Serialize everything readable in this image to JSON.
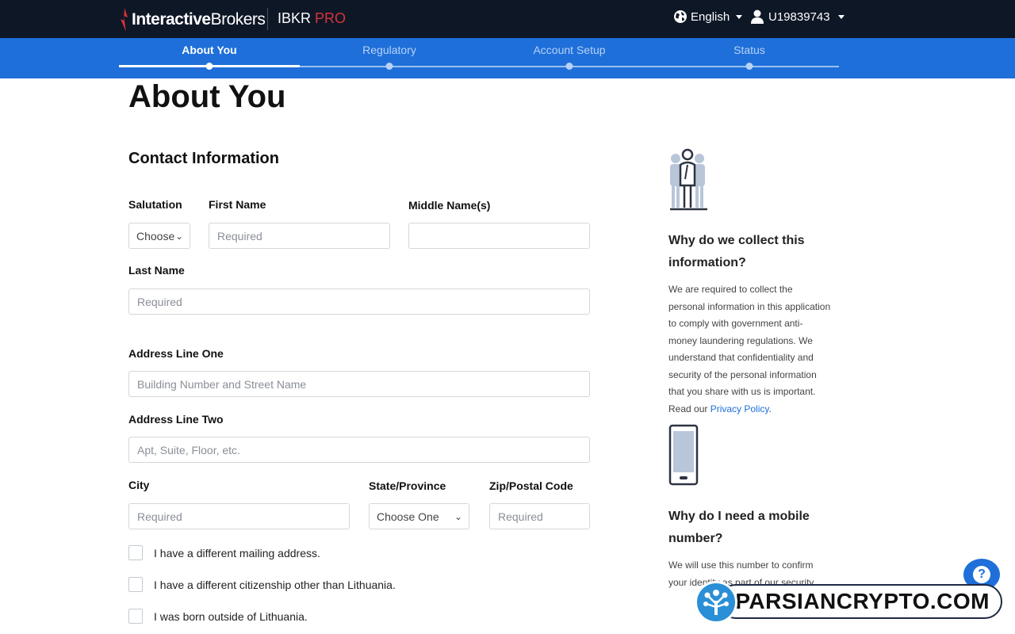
{
  "header": {
    "logo_text_a": "Interactive",
    "logo_text_b": "Brokers",
    "product": "IBKR",
    "product_tier": "PRO",
    "language": "English",
    "user_id": "U19839743"
  },
  "steps": [
    {
      "label": "About You",
      "active": true
    },
    {
      "label": "Regulatory",
      "active": false
    },
    {
      "label": "Account Setup",
      "active": false
    },
    {
      "label": "Status",
      "active": false
    }
  ],
  "page_title": "About You",
  "section_title": "Contact Information",
  "form": {
    "salutation_label": "Salutation",
    "salutation_value": "Choose",
    "first_name_label": "First Name",
    "first_name_placeholder": "Required",
    "middle_name_label": "Middle Name(s)",
    "middle_name_placeholder": "",
    "last_name_label": "Last Name",
    "last_name_placeholder": "Required",
    "address1_label": "Address Line One",
    "address1_placeholder": "Building Number and Street Name",
    "address2_label": "Address Line Two",
    "address2_placeholder": "Apt, Suite, Floor, etc.",
    "city_label": "City",
    "city_placeholder": "Required",
    "state_label": "State/Province",
    "state_value": "Choose One",
    "zip_label": "Zip/Postal Code",
    "zip_placeholder": "Required"
  },
  "checkboxes": [
    "I have a different mailing address.",
    "I have a different citizenship other than Lithuania.",
    "I was born outside of Lithuania."
  ],
  "sidebar": {
    "info_title": "Why do we collect this information?",
    "info_text": "We are required to collect the personal information in this application to comply with government anti-money laundering regulations. We understand that confidentiality and security of the personal information that you share with us is important. Read our ",
    "info_link": "Privacy Policy",
    "info_end": ".",
    "mobile_title": "Why do I need a mobile number?",
    "mobile_text": "We will use this number to confirm your identity as part of our security measures"
  },
  "help_label": "?",
  "watermark": "PARSIANCRYPTO.COM",
  "colors": {
    "topbar": "#0e1726",
    "stepbar": "#1e6fd9",
    "accent_red": "#d9323a",
    "link": "#1e6fd9"
  }
}
